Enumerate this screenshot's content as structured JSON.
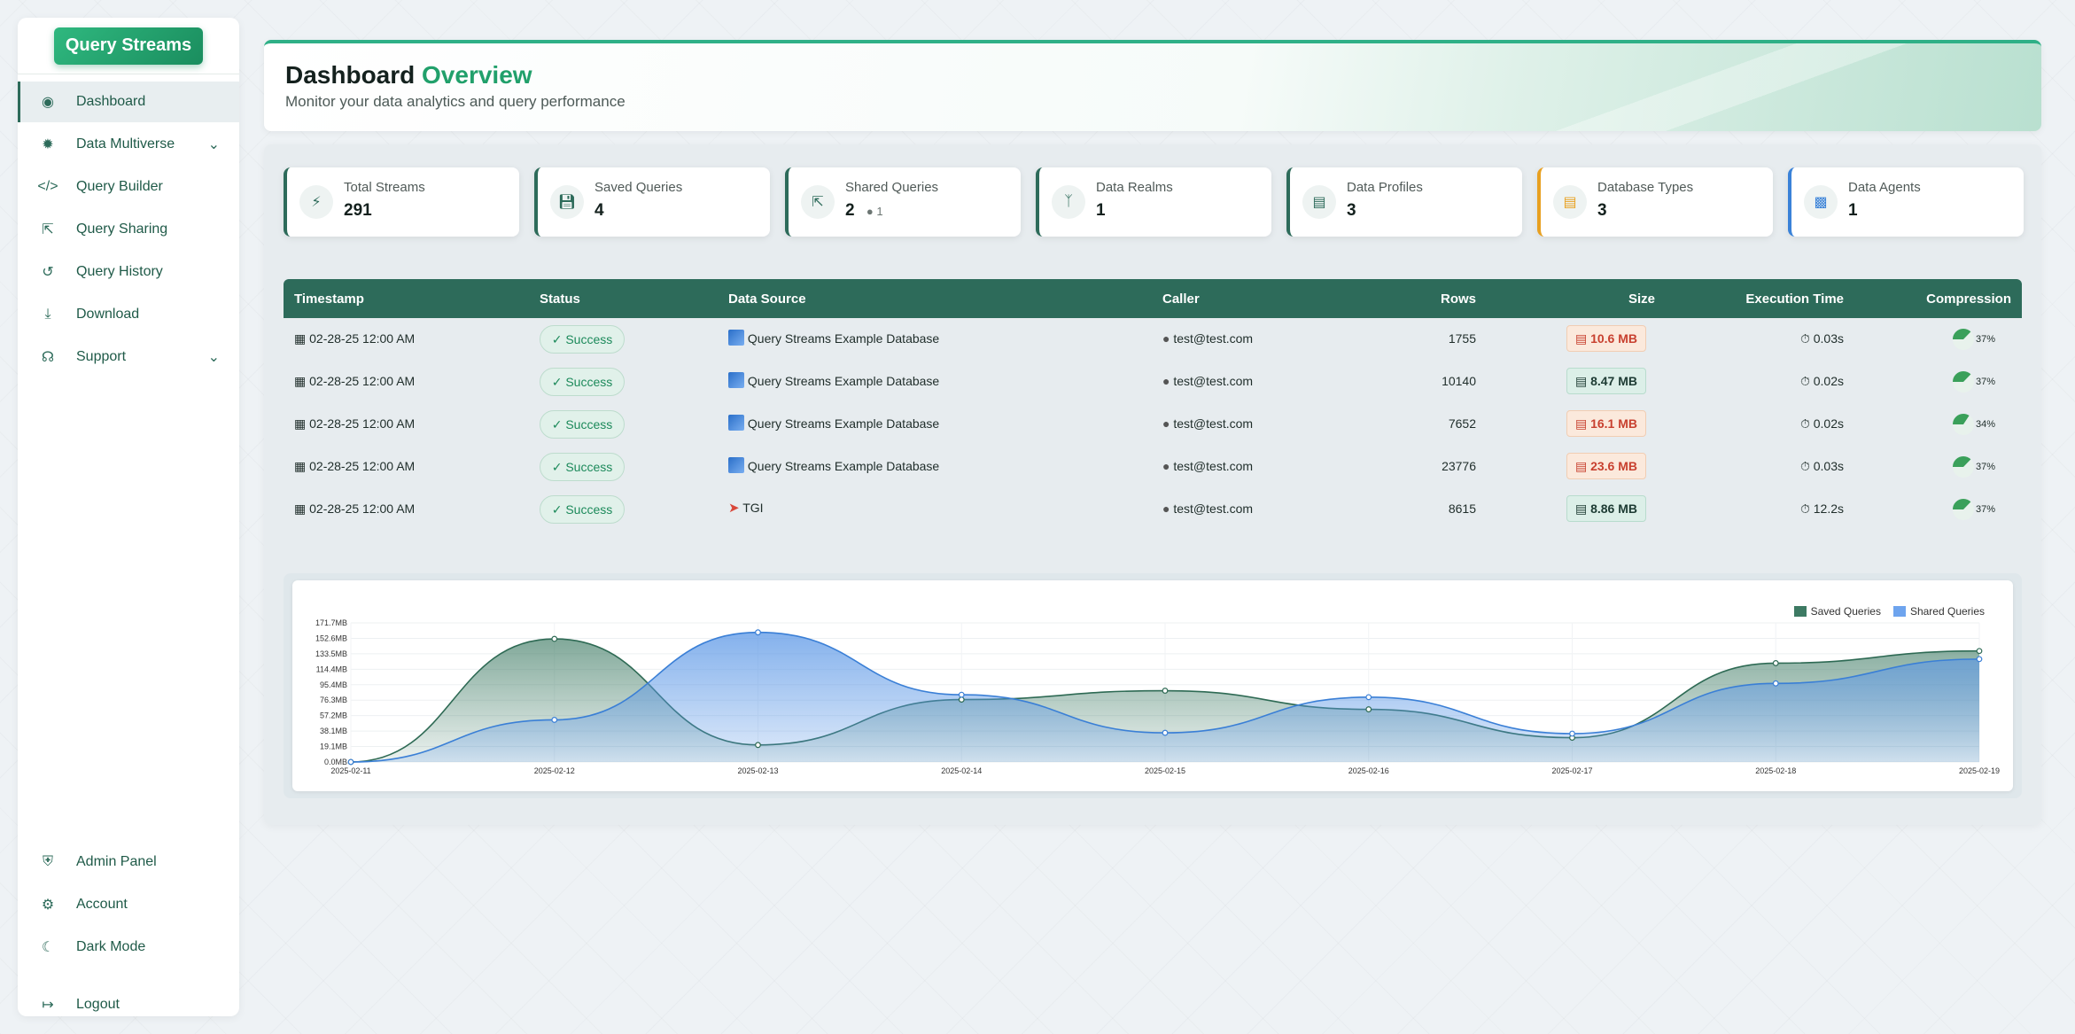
{
  "sidebar": {
    "brand": "Query Streams",
    "items": [
      {
        "label": "Dashboard",
        "icon": "gauge-icon"
      },
      {
        "label": "Data Multiverse",
        "icon": "cube-icon"
      },
      {
        "label": "Query Builder",
        "icon": "code-icon"
      },
      {
        "label": "Query Sharing",
        "icon": "share-icon"
      },
      {
        "label": "Query History",
        "icon": "history-icon"
      },
      {
        "label": "Download",
        "icon": "download-icon"
      },
      {
        "label": "Support",
        "icon": "headset-icon"
      }
    ],
    "bottom_items": [
      {
        "label": "Admin Panel",
        "icon": "shield-icon"
      },
      {
        "label": "Account",
        "icon": "user-cog-icon"
      },
      {
        "label": "Dark Mode",
        "icon": "moon-icon"
      },
      {
        "label": "Logout",
        "icon": "logout-icon"
      }
    ]
  },
  "header": {
    "title_part1": "Dashboard",
    "title_part2": "Overview",
    "subtitle": "Monitor your data analytics and query performance"
  },
  "stats": [
    {
      "label": "Total Streams",
      "value": "291",
      "icon": "bolt-icon"
    },
    {
      "label": "Saved Queries",
      "value": "4",
      "icon": "save-icon"
    },
    {
      "label": "Shared Queries",
      "value": "2",
      "sub": "1",
      "icon": "share-icon"
    },
    {
      "label": "Data Realms",
      "value": "1",
      "icon": "branch-icon"
    },
    {
      "label": "Data Profiles",
      "value": "3",
      "icon": "server-icon"
    },
    {
      "label": "Database Types",
      "value": "3",
      "icon": "database-icon"
    },
    {
      "label": "Data Agents",
      "value": "1",
      "icon": "robot-icon"
    }
  ],
  "table": {
    "headers": [
      "Timestamp",
      "Status",
      "Data Source",
      "Caller",
      "Rows",
      "Size",
      "Execution Time",
      "Compression"
    ],
    "rows": [
      {
        "timestamp": "02-28-25 12:00 AM",
        "status": "Success",
        "source": "Query Streams Example Database",
        "source_icon": "sqlite-icon",
        "caller": "test@test.com",
        "rows": "1755",
        "size": "10.6 MB",
        "size_level": "high",
        "time": "0.03s",
        "compression": "37%",
        "compression_value": 37
      },
      {
        "timestamp": "02-28-25 12:00 AM",
        "status": "Success",
        "source": "Query Streams Example Database",
        "source_icon": "sqlite-icon",
        "caller": "test@test.com",
        "rows": "10140",
        "size": "8.47 MB",
        "size_level": "normal",
        "time": "0.02s",
        "compression": "37%",
        "compression_value": 37
      },
      {
        "timestamp": "02-28-25 12:00 AM",
        "status": "Success",
        "source": "Query Streams Example Database",
        "source_icon": "sqlite-icon",
        "caller": "test@test.com",
        "rows": "7652",
        "size": "16.1 MB",
        "size_level": "high",
        "time": "0.02s",
        "compression": "34%",
        "compression_value": 34
      },
      {
        "timestamp": "02-28-25 12:00 AM",
        "status": "Success",
        "source": "Query Streams Example Database",
        "source_icon": "sqlite-icon",
        "caller": "test@test.com",
        "rows": "23776",
        "size": "23.6 MB",
        "size_level": "high",
        "time": "0.03s",
        "compression": "37%",
        "compression_value": 37
      },
      {
        "timestamp": "02-28-25 12:00 AM",
        "status": "Success",
        "source": "TGI",
        "source_icon": "tgi-icon",
        "caller": "test@test.com",
        "rows": "8615",
        "size": "8.86 MB",
        "size_level": "normal",
        "time": "12.2s",
        "compression": "37%",
        "compression_value": 37
      }
    ]
  },
  "colors": {
    "primary": "#2d6b5a",
    "accent": "#21a06b",
    "saved_series": "#3d7a63",
    "shared_series": "#5b97e6"
  },
  "chart_data": {
    "type": "area",
    "x": [
      "2025-02-11",
      "2025-02-12",
      "2025-02-13",
      "2025-02-14",
      "2025-02-15",
      "2025-02-16",
      "2025-02-17",
      "2025-02-18",
      "2025-02-19"
    ],
    "y_ticks": [
      "0.0MB",
      "19.1MB",
      "38.1MB",
      "57.2MB",
      "76.3MB",
      "95.4MB",
      "114.4MB",
      "133.5MB",
      "152.6MB",
      "171.7MB"
    ],
    "ylim": [
      0,
      171.7
    ],
    "y_unit": "MB",
    "legend_position": "top-right",
    "series": [
      {
        "name": "Saved Queries",
        "values": [
          0,
          152,
          21,
          77,
          88,
          65,
          30,
          122,
          137
        ]
      },
      {
        "name": "Shared Queries",
        "values": [
          0,
          52,
          160,
          83,
          36,
          80,
          35,
          97,
          127
        ]
      }
    ]
  }
}
